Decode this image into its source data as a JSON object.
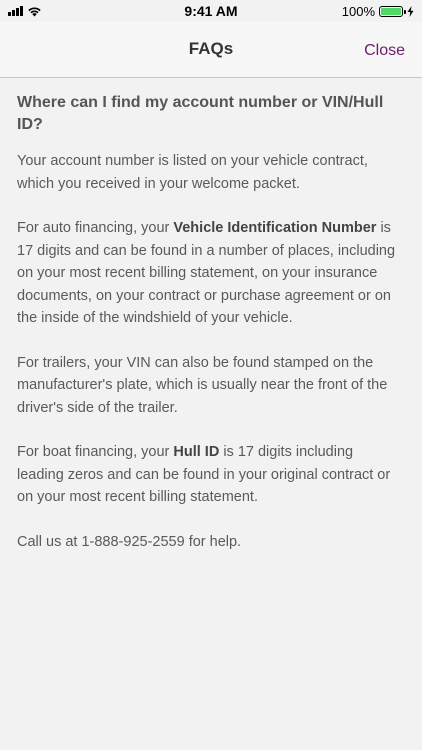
{
  "status_bar": {
    "time": "9:41 AM",
    "battery_percent": "100%",
    "battery_level": 1.0,
    "icons": [
      "signal-icon",
      "wifi-icon",
      "battery-icon",
      "charging-icon"
    ]
  },
  "nav": {
    "title": "FAQs",
    "close_label": "Close",
    "close_color": "#6b1e6e"
  },
  "faq": {
    "question": "Where can I find my account number or VIN/Hull ID?",
    "p1": "Your account number is listed on your vehicle contract, which you received in your welcome packet.",
    "p2_before": "For auto financing, your ",
    "p2_bold": "Vehicle Identification Number",
    "p2_after": " is 17 digits and can be found in a number of places, including on your most recent billing statement, on your insurance documents, on your contract or purchase agreement or on the inside of the windshield of your vehicle.",
    "p3": "For trailers, your VIN can also be found stamped on the manufacturer's plate, which is usually near the front of the driver's side of the trailer.",
    "p4_before": "For boat financing, your ",
    "p4_bold": "Hull ID",
    "p4_after": " is 17 digits including leading zeros and can be found in your original contract or on your most recent billing statement.",
    "p5": "Call us at 1-888-925-2559 for help."
  }
}
